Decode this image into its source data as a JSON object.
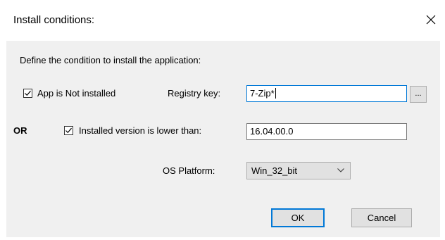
{
  "dialog": {
    "title": "Install conditions:",
    "close_icon": "close-icon"
  },
  "instructions": "Define the condition to install the application:",
  "app_not_installed": {
    "label": "App is Not installed",
    "checked": true
  },
  "registry_key": {
    "label": "Registry key:",
    "value": "7-Zip*",
    "browse_label": "..."
  },
  "or_label": "OR",
  "version_condition": {
    "label": "Installed version is lower than:",
    "checked": true,
    "value": "16.04.00.0"
  },
  "os_platform": {
    "label": "OS Platform:",
    "selected": "Win_32_bit"
  },
  "buttons": {
    "ok": "OK",
    "cancel": "Cancel"
  },
  "colors": {
    "accent": "#0078d7",
    "panel": "#f0f0f0"
  }
}
